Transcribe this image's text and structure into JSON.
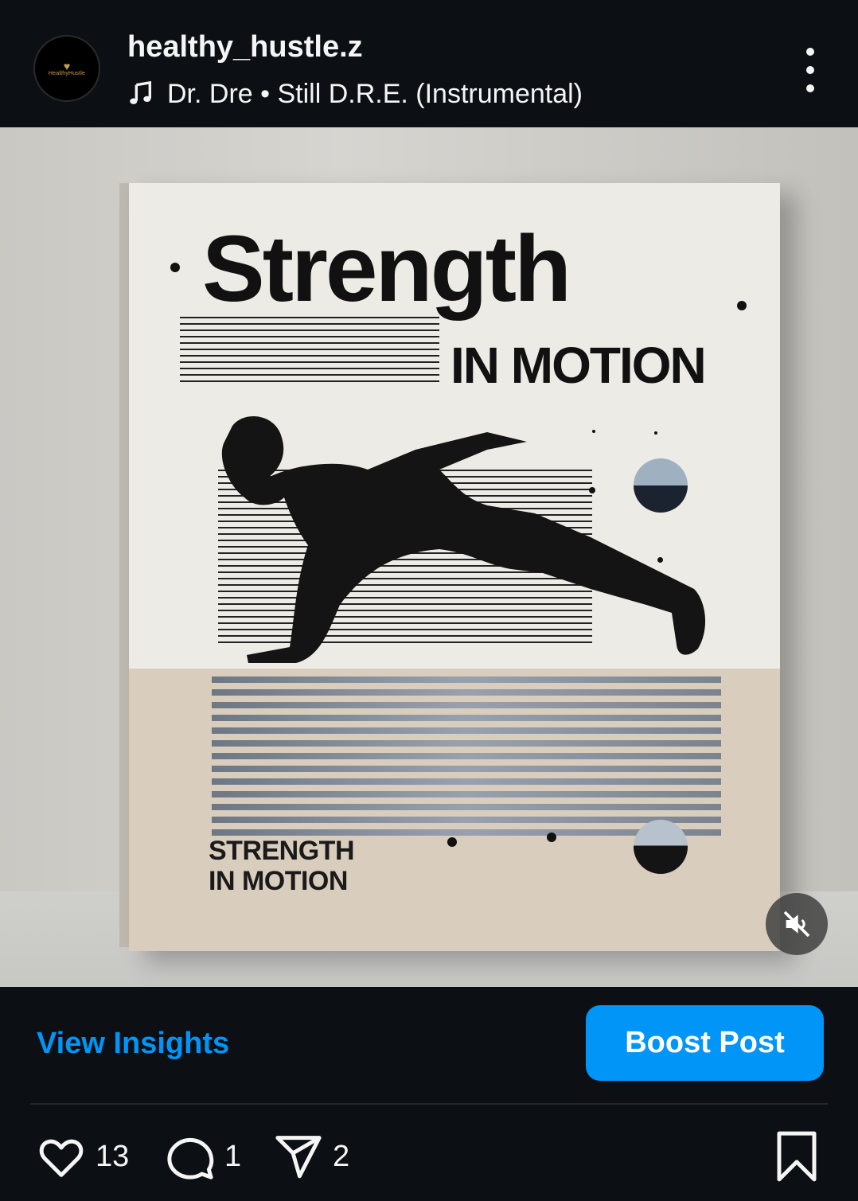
{
  "header": {
    "avatar_heart": "♥",
    "avatar_brand": "HealthyHustle",
    "username": "healthy_hustle.z",
    "music_icon": "music-note-icon",
    "track": "Dr. Dre • Still D.R.E. (Instrumental)",
    "more_icon": "more-vertical-icon"
  },
  "post_image": {
    "title_main": "Strength",
    "title_sub": "IN MOTION",
    "caption_line1": "STRENGTH",
    "caption_line2": "IN MOTION",
    "mute_icon": "volume-off-icon"
  },
  "actions": {
    "view_insights": "View Insights",
    "boost_post": "Boost Post",
    "like_icon": "heart-icon",
    "like_count": "13",
    "comment_icon": "comment-icon",
    "comment_count": "1",
    "share_icon": "send-icon",
    "share_count": "2",
    "save_icon": "bookmark-icon"
  },
  "colors": {
    "background": "#0c1014",
    "accent": "#0095f6",
    "text": "#f5f5f5"
  }
}
